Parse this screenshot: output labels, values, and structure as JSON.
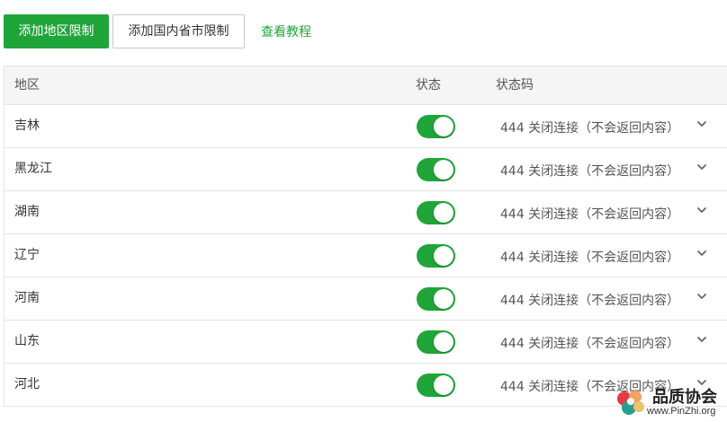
{
  "toolbar": {
    "add_region_label": "添加地区限制",
    "add_province_label": "添加国内省市限制",
    "tutorial_label": "查看教程"
  },
  "table": {
    "headers": {
      "region": "地区",
      "status": "状态",
      "status_code": "状态码"
    },
    "rows": [
      {
        "region": "吉林",
        "enabled": true,
        "status_code": "444 关闭连接（不会返回内容）"
      },
      {
        "region": "黑龙江",
        "enabled": true,
        "status_code": "444 关闭连接（不会返回内容）"
      },
      {
        "region": "湖南",
        "enabled": true,
        "status_code": "444 关闭连接（不会返回内容）"
      },
      {
        "region": "辽宁",
        "enabled": true,
        "status_code": "444 关闭连接（不会返回内容）"
      },
      {
        "region": "河南",
        "enabled": true,
        "status_code": "444 关闭连接（不会返回内容）"
      },
      {
        "region": "山东",
        "enabled": true,
        "status_code": "444 关闭连接（不会返回内容）"
      },
      {
        "region": "河北",
        "enabled": true,
        "status_code": "444 关闭连接（不会返回内容）"
      }
    ]
  },
  "watermark": {
    "name": "品质协会",
    "url": "www.PinZhi.org"
  },
  "colors": {
    "accent": "#20a53a",
    "border": "#e4e4e4",
    "header_bg": "#f5f5f5"
  },
  "icons": {
    "dropdown": "chevron-down-icon"
  }
}
